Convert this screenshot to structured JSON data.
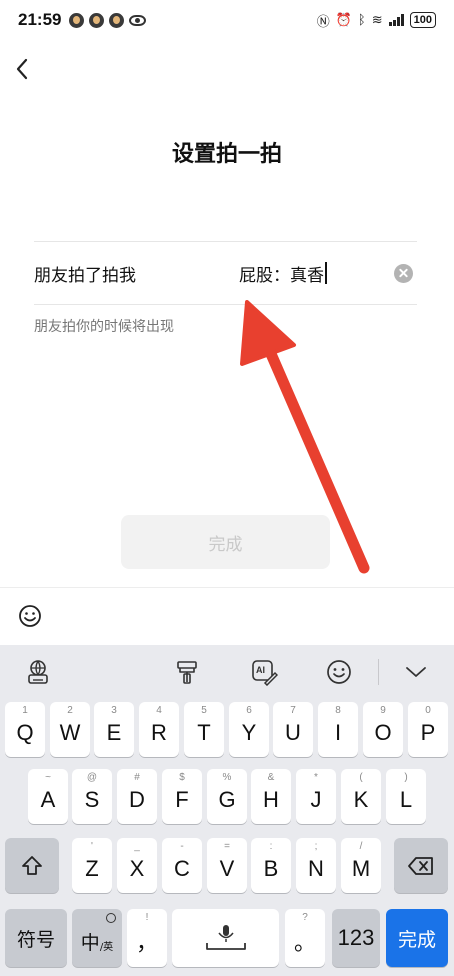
{
  "status_bar": {
    "time": "21:59",
    "battery": "100"
  },
  "page": {
    "title": "设置拍一拍",
    "prefix": "朋友拍了拍我",
    "input_value": "屁股：真香",
    "hint": "朋友拍你的时候将出现",
    "done_label": "完成"
  },
  "keyboard": {
    "toolbar_icons": [
      "keyboard-globe-icon",
      "brush-icon",
      "ai-pen-icon",
      "smiley-icon",
      "chevron-down-icon"
    ],
    "row1": [
      {
        "num": "1",
        "label": "Q"
      },
      {
        "num": "2",
        "label": "W"
      },
      {
        "num": "3",
        "label": "E"
      },
      {
        "num": "4",
        "label": "R"
      },
      {
        "num": "5",
        "label": "T"
      },
      {
        "num": "6",
        "label": "Y"
      },
      {
        "num": "7",
        "label": "U"
      },
      {
        "num": "8",
        "label": "I"
      },
      {
        "num": "9",
        "label": "O"
      },
      {
        "num": "0",
        "label": "P"
      }
    ],
    "row2": [
      {
        "sym": "~",
        "label": "A"
      },
      {
        "sym": "@",
        "label": "S"
      },
      {
        "sym": "#",
        "label": "D"
      },
      {
        "sym": "$",
        "label": "F"
      },
      {
        "sym": "%",
        "label": "G"
      },
      {
        "sym": "&",
        "label": "H"
      },
      {
        "sym": "*",
        "label": "J"
      },
      {
        "sym": "(",
        "label": "K"
      },
      {
        "sym": ")",
        "label": "L"
      }
    ],
    "row3": [
      {
        "sym": "'",
        "label": "Z"
      },
      {
        "sym": "_",
        "label": "X"
      },
      {
        "sym": "-",
        "label": "C"
      },
      {
        "sym": "=",
        "label": "V"
      },
      {
        "sym": ":",
        "label": "B"
      },
      {
        "sym": ";",
        "label": "N"
      },
      {
        "sym": "/",
        "label": "M"
      }
    ],
    "symbols_label": "符号",
    "lang_main": "中",
    "lang_sub": "/英",
    "comma_sup": "!",
    "comma_label": "，",
    "period_sup": "?",
    "period_label": "。",
    "num_label": "123",
    "done_label": "完成"
  },
  "colors": {
    "arrow": "#e8402f",
    "accent": "#1a73e8"
  }
}
